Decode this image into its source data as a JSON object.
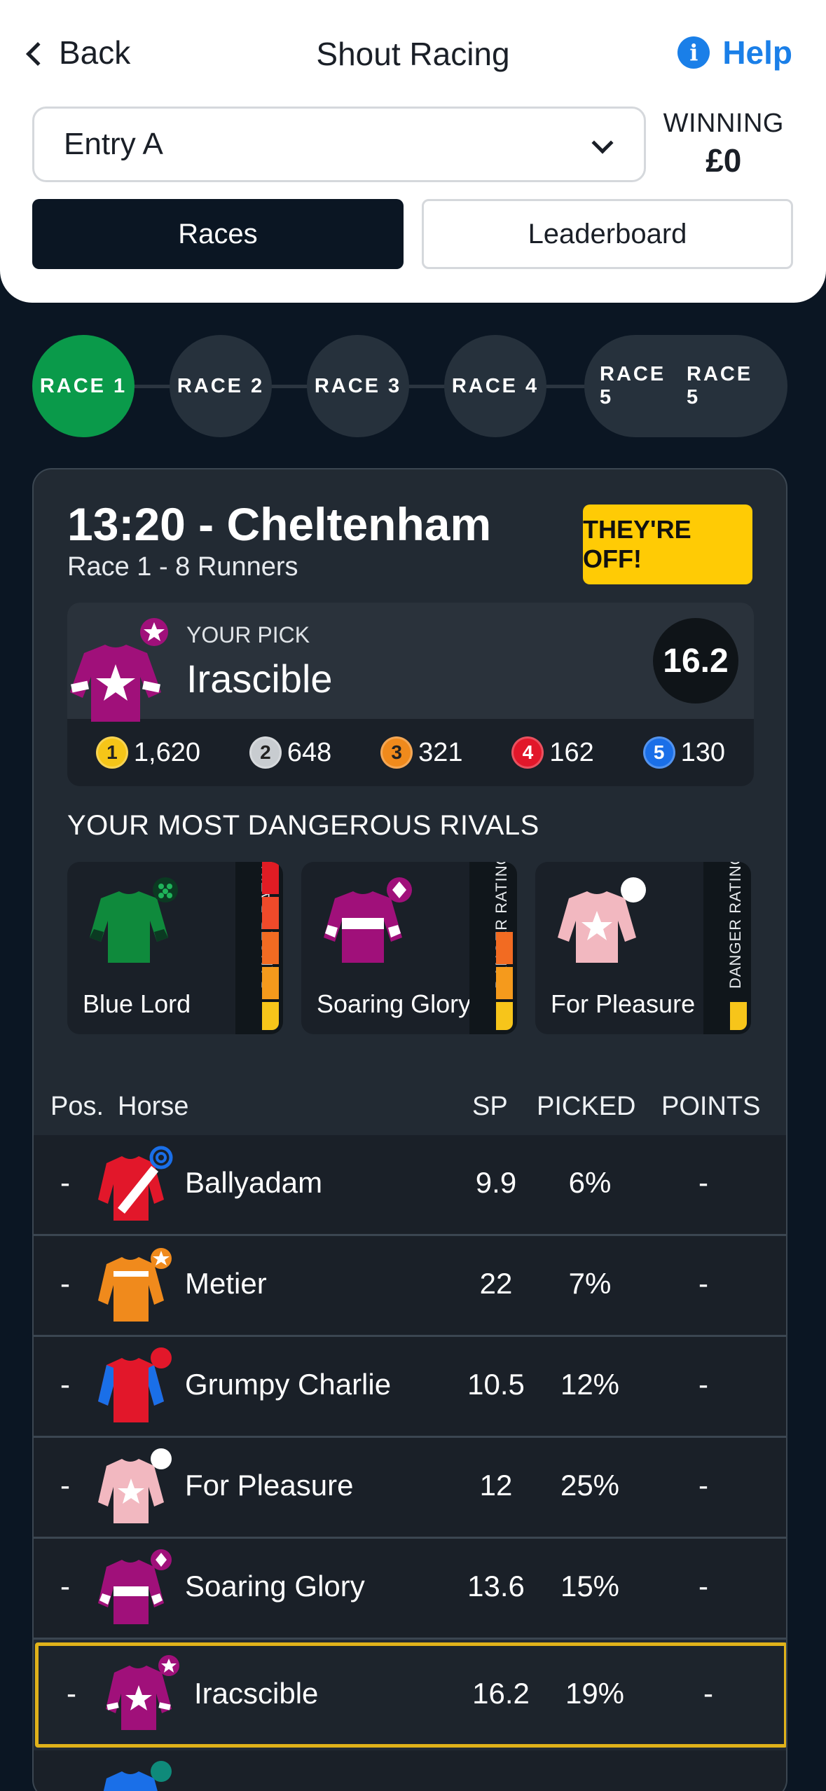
{
  "header": {
    "back_label": "Back",
    "title": "Shout Racing",
    "help_label": "Help",
    "entry_selected": "Entry A",
    "winning_label": "WINNING",
    "winning_value": "£0",
    "tabs": [
      {
        "label": "Races",
        "active": true
      },
      {
        "label": "Leaderboard",
        "active": false
      }
    ]
  },
  "race_tabs": [
    "RACE 1",
    "RACE 2",
    "RACE 3",
    "RACE 4",
    "RACE 5",
    "RACE 5"
  ],
  "race_card": {
    "title": "13:20 - Cheltenham",
    "subtitle": "Race 1 - 8 Runners",
    "status_button": "THEY'RE OFF!",
    "pick": {
      "label": "YOUR PICK",
      "horse": "Irascible",
      "odds": "16.2",
      "positions": [
        {
          "rank": "1",
          "value": "1,620",
          "color": "#f5c518"
        },
        {
          "rank": "2",
          "value": "648",
          "color": "#c8ccd0"
        },
        {
          "rank": "3",
          "value": "321",
          "color": "#f08a1c"
        },
        {
          "rank": "4",
          "value": "162",
          "color": "#e2172a"
        },
        {
          "rank": "5",
          "value": "130",
          "color": "#1a6fe8"
        }
      ]
    },
    "rivals_heading": "YOUR MOST DANGEROUS RIVALS",
    "rivals": [
      {
        "name": "Blue Lord",
        "danger_label": "DANGER RATING",
        "danger_level": 5
      },
      {
        "name": "Soaring Glory",
        "danger_label": "DANGER RATING",
        "danger_level": 3
      },
      {
        "name": "For Pleasure",
        "danger_label": "DANGER RATING",
        "danger_level": 1
      }
    ],
    "table": {
      "headers": {
        "pos": "Pos.",
        "horse": "Horse",
        "sp": "SP",
        "picked": "PICKED",
        "points": "POINTS"
      },
      "rows": [
        {
          "pos": "-",
          "horse": "Ballyadam",
          "sp": "9.9",
          "picked": "6%",
          "points": "-"
        },
        {
          "pos": "-",
          "horse": "Metier",
          "sp": "22",
          "picked": "7%",
          "points": "-"
        },
        {
          "pos": "-",
          "horse": "Grumpy Charlie",
          "sp": "10.5",
          "picked": "12%",
          "points": "-"
        },
        {
          "pos": "-",
          "horse": "For Pleasure",
          "sp": "12",
          "picked": "25%",
          "points": "-"
        },
        {
          "pos": "-",
          "horse": "Soaring Glory",
          "sp": "13.6",
          "picked": "15%",
          "points": "-"
        },
        {
          "pos": "-",
          "horse": "Iracscible",
          "sp": "16.2",
          "picked": "19%",
          "points": "-"
        }
      ]
    }
  },
  "colors": {
    "accent_blue": "#1a7fe8",
    "active_green": "#0a9a4a",
    "highlight_gold": "#e0b21a",
    "cta_yellow": "#ffcb05"
  }
}
